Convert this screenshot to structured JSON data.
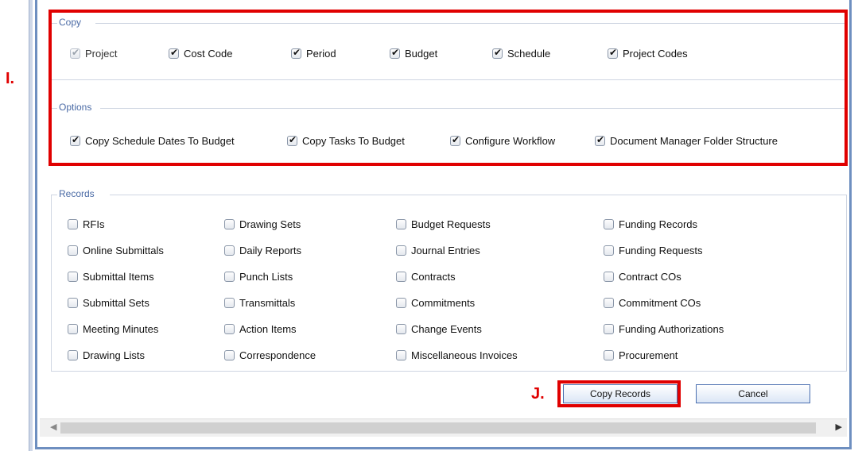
{
  "copy": {
    "legend": "Copy",
    "items": [
      {
        "label": "Project",
        "checked": true,
        "disabled": true
      },
      {
        "label": "Cost Code",
        "checked": true
      },
      {
        "label": "Period",
        "checked": true
      },
      {
        "label": "Budget",
        "checked": true
      },
      {
        "label": "Schedule",
        "checked": true
      },
      {
        "label": "Project Codes",
        "checked": true
      }
    ]
  },
  "options": {
    "legend": "Options",
    "items": [
      {
        "label": "Copy Schedule Dates To Budget",
        "checked": true
      },
      {
        "label": "Copy Tasks To Budget",
        "checked": true
      },
      {
        "label": "Configure Workflow",
        "checked": true
      },
      {
        "label": "Document Manager Folder Structure",
        "checked": true
      }
    ]
  },
  "records": {
    "legend": "Records",
    "items": [
      "RFIs",
      "Drawing Sets",
      "Budget Requests",
      "Funding Records",
      "Online Submittals",
      "Daily Reports",
      "Journal Entries",
      "Funding Requests",
      "Submittal Items",
      "Punch Lists",
      "Contracts",
      "Contract COs",
      "Submittal Sets",
      "Transmittals",
      "Commitments",
      "Commitment COs",
      "Meeting Minutes",
      "Action Items",
      "Change Events",
      "Funding Authorizations",
      "Drawing Lists",
      "Correspondence",
      "Miscellaneous Invoices",
      "Procurement"
    ]
  },
  "markers": {
    "i": "I.",
    "j": "J."
  },
  "buttons": {
    "copy_records": "Copy Records",
    "cancel": "Cancel"
  },
  "icons": {
    "scroll_left": "arrow-left-icon",
    "scroll_right": "arrow-right-icon"
  },
  "colors": {
    "highlight": "#e00000",
    "legend": "#4a6aa5",
    "frame": "#6e8fc0"
  }
}
